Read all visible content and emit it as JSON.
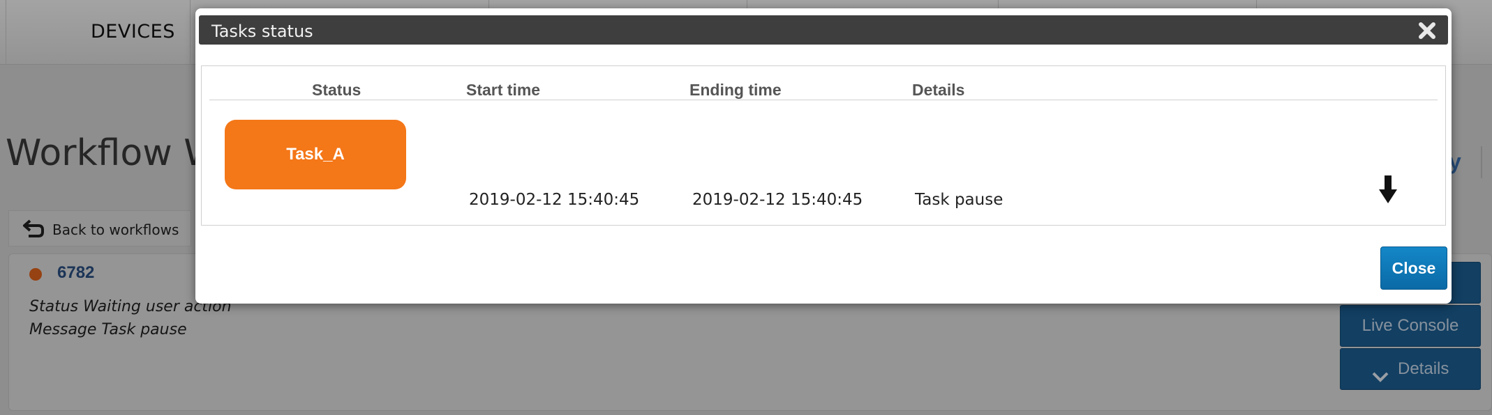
{
  "nav": {
    "devices_label": "DEVICES"
  },
  "page": {
    "title": "Workflow Wi",
    "right_link": "y"
  },
  "back": {
    "label": "Back to workflows"
  },
  "workflow": {
    "id": "6782",
    "status_line": "Status  Waiting user action",
    "message_line": "Message  Task pause",
    "status_color": "#e0631c"
  },
  "side_buttons": {
    "console": "Live Console",
    "details": "Details"
  },
  "modal": {
    "title": "Tasks status",
    "columns": {
      "status": "Status",
      "start": "Start time",
      "end": "Ending time",
      "details": "Details"
    },
    "task": {
      "name": "Task_A",
      "start_time": "2019-02-12 15:40:45",
      "end_time": "2019-02-12 15:40:45",
      "details": "Task pause",
      "status_color": "#f47718"
    },
    "close_label": "Close"
  },
  "icons": {
    "close": "close-x-icon",
    "download": "download-arrow-icon",
    "back": "back-arrow-icon",
    "chevron": "chevron-down-icon"
  },
  "colors": {
    "accent_button": "#1487c8",
    "header_bar": "#3e3e3e",
    "link": "#2a4f82"
  }
}
